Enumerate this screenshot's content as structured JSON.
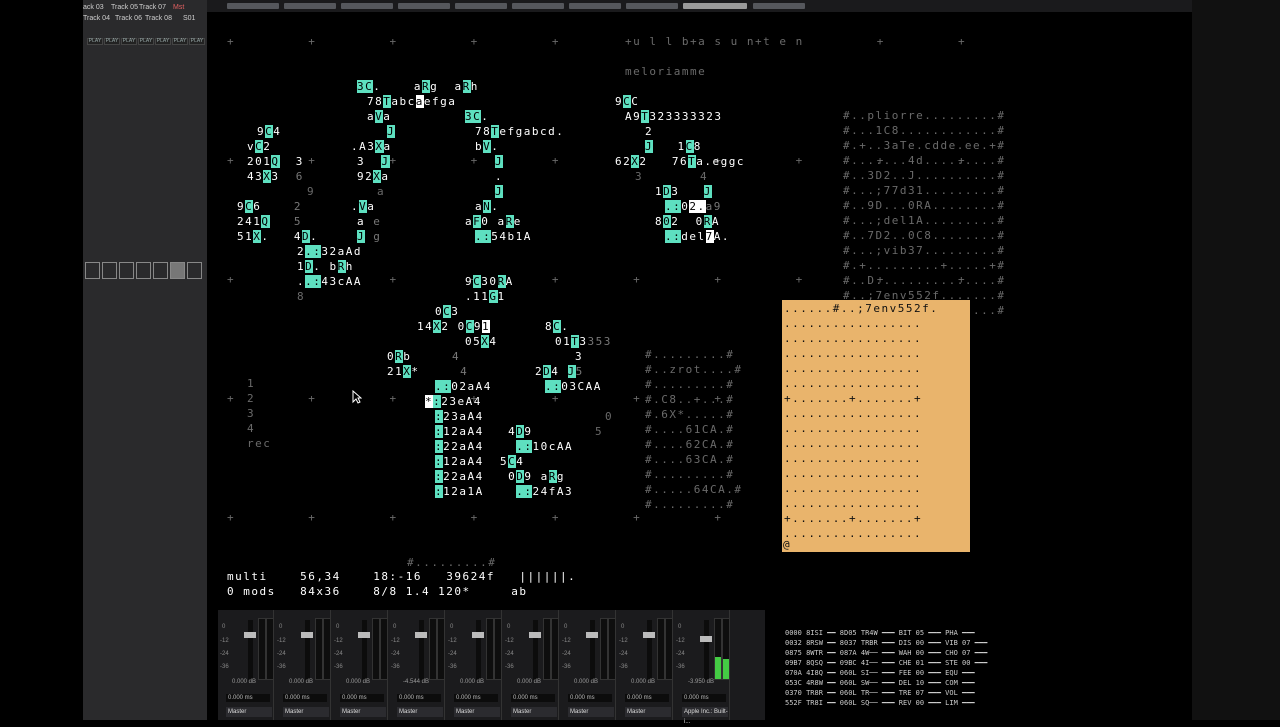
{
  "daw": {
    "tracks_row1": [
      "ack 03",
      "Track 05",
      "Track 07",
      "Mst"
    ],
    "tracks_row2": [
      "Track 04",
      "Track 06",
      "Track 08",
      "S01"
    ],
    "play_label": "PLAY",
    "mixer_channels": [
      {
        "db": "0.000 dB",
        "ms": "0.000 ms",
        "out": "Master"
      },
      {
        "db": "0.000 dB",
        "ms": "0.000 ms",
        "out": "Master"
      },
      {
        "db": "0.000 dB",
        "ms": "0.000 ms",
        "out": "Master"
      },
      {
        "db": "-4.544 dB",
        "ms": "0.000 ms",
        "out": "Master"
      },
      {
        "db": "0.000 dB",
        "ms": "0.000 ms",
        "out": "Master"
      },
      {
        "db": "0.000 dB",
        "ms": "0.000 ms",
        "out": "Master"
      },
      {
        "db": "0.000 dB",
        "ms": "0.000 ms",
        "out": "Master"
      },
      {
        "db": "0.000 dB",
        "ms": "0.000 ms",
        "out": "Master"
      },
      {
        "db": "-3.950 dB",
        "ms": "0.000 ms",
        "out": "Apple Inc.: Built-i..."
      }
    ],
    "db_scale": [
      "0",
      "-12",
      "-24",
      "-36"
    ],
    "readout_lines": [
      "0000 8ISI ━━ 8D05 TR4W ━━━ BIT 05 ━━━ PHA ━━━",
      "0032 8RSW ━━ 8037 TRBR ━━━ DIS 00 ━━━ VIB 07 ━━━",
      "0875 8WTR ━━ 087A 4W── ━━━ WAH 00 ━━━ CHO 07 ━━━",
      "09B7 8QSQ ━━ 09BC 4I── ━━━ CHE 01 ━━━ STE 00 ━━━",
      "070A 4I8Q ━━ 060L SI── ━━━ FEE 00 ━━━ EQU ━━━",
      "053C 4R8W ━━ 060L SW── ━━━ DEL 10 ━━━ COM ━━━",
      "0370 TR8R ━━ 060L TR── ━━━ TRE 07 ━━━ VOL ━━━",
      "552F TR8I ━━ 060L SQ── ━━━ REV 00 ━━━ LIM ━━━"
    ]
  },
  "orca": {
    "title": "+u l l b+a s u n+t e n",
    "subtitle": "meloriamme",
    "status": {
      "line1": "multi    56,34    18:-16   39624f   ||||||.",
      "line2": "0 mods   84x36    8/8 1.4 120*     ab"
    },
    "footer_hash": "#.........#",
    "side_numbers": [
      "1",
      "2",
      "3",
      "4"
    ],
    "rec_label": "rec",
    "comment_block_right": [
      "#..pliorre.........#",
      "#...1C8............#",
      "#.+..3aTe.cdde.ee.+#",
      "#.......4d.........#",
      "#..3D2..J..........#",
      "#...;77d31.........#",
      "#..9D...0RA........#",
      "#...;del1A.........#",
      "#..7D2..0C8........#",
      "#...;vib37.........#",
      "#.+.........+.....+#",
      "#..D...............#",
      "#..;7env552f.......#",
      "#..................#"
    ],
    "comment_block_mid": [
      "#.........#",
      "#..zrot....#",
      "#.........#",
      "#.C8..+...#",
      "#.6X*.....#",
      "#....61CA.#",
      "#....62CA.#",
      "#....63CA.#",
      "#.........#",
      "#.....64CA.#",
      "#.........#"
    ],
    "orange_first_line": "......#..;7env552f.",
    "orange_last_char": "@"
  }
}
